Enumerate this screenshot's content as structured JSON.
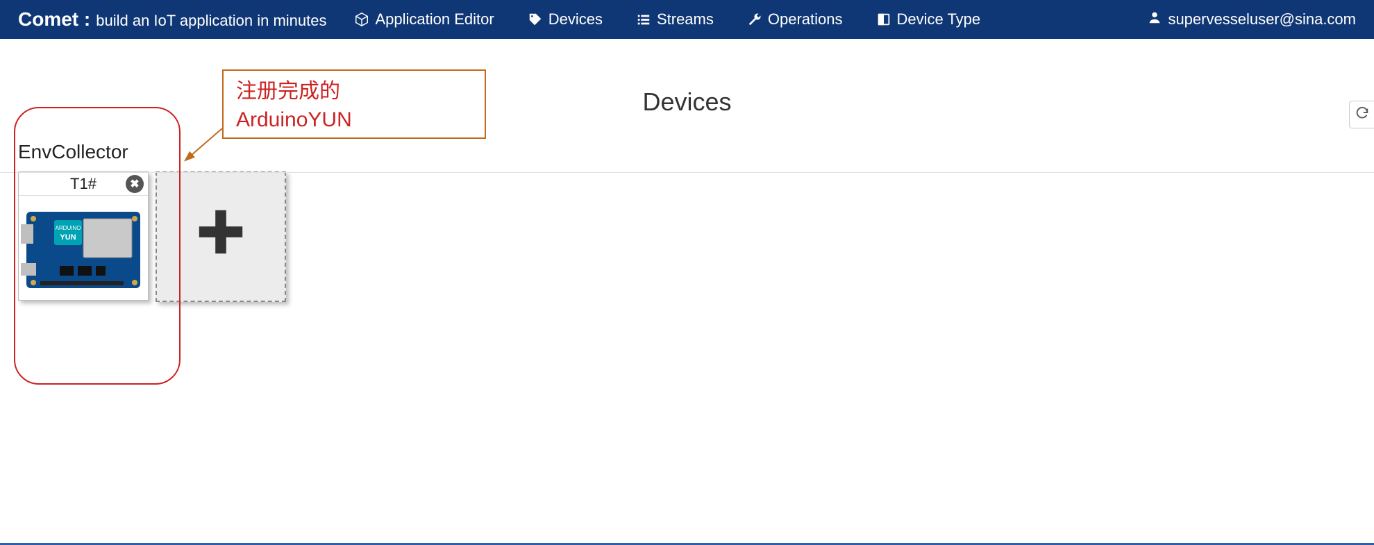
{
  "brand": {
    "name": "Comet :",
    "sub": "build an IoT application in minutes"
  },
  "nav": {
    "app_editor": "Application Editor",
    "devices": "Devices",
    "streams": "Streams",
    "operations": "Operations",
    "device_type": "Device Type"
  },
  "user": {
    "email": "supervesseluser@sina.com"
  },
  "page": {
    "title": "Devices"
  },
  "group": {
    "name": "EnvCollector"
  },
  "device_card": {
    "title": "T1#",
    "board_label": "ARDUINO",
    "board_model": "YUN"
  },
  "annotation": {
    "line1": "注册完成的",
    "line2": "ArduinoYUN"
  },
  "colors": {
    "navbar_bg": "#103775",
    "annotation_border": "#c06a1c",
    "annotation_text": "#cc2222"
  }
}
